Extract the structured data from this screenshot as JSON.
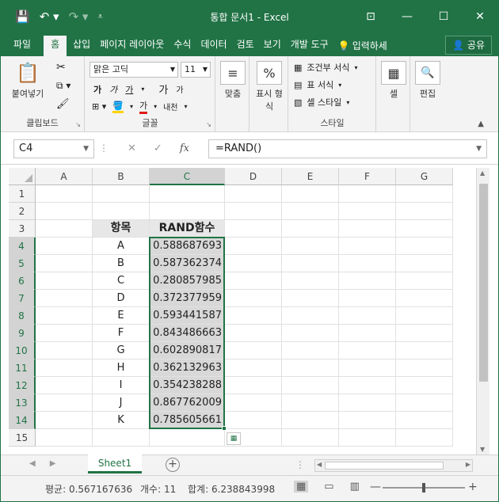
{
  "window": {
    "title": "통합 문서1 - Excel",
    "qat": {
      "save_icon": "save-icon",
      "undo_icon": "undo-icon",
      "redo_icon": "redo-icon"
    },
    "controls": [
      "ribbon-display-icon",
      "minimize-icon",
      "maximize-icon",
      "close-icon"
    ]
  },
  "tabs": [
    {
      "label": "파일"
    },
    {
      "label": "홈",
      "active": true
    },
    {
      "label": "삽입"
    },
    {
      "label": "페이지 레이아웃"
    },
    {
      "label": "수식"
    },
    {
      "label": "데이터"
    },
    {
      "label": "검토"
    },
    {
      "label": "보기"
    },
    {
      "label": "개발 도구"
    }
  ],
  "tell_me": "입력하세",
  "share": "공유",
  "ribbon": {
    "clipboard": {
      "paste_label": "붙여넣기",
      "group": "클립보드"
    },
    "font": {
      "name": "맑은 고딕",
      "size": "11",
      "group": "글꼴",
      "bold": "가",
      "italic": "가",
      "underline": "가",
      "grow": "가",
      "shrink": "가",
      "fontcolor": "가",
      "phonetic": "내천"
    },
    "alignment": {
      "label": "맞춤"
    },
    "number": {
      "label": "표시 형식"
    },
    "styles": {
      "cond": "조건부 서식",
      "table": "표 서식",
      "cell": "셀 스타일",
      "group": "스타일"
    },
    "cells": {
      "label": "셀"
    },
    "editing": {
      "label": "편집"
    }
  },
  "formula_bar": {
    "name_box": "C4",
    "cancel": "✕",
    "enter": "✓",
    "fx": "fx",
    "formula": "=RAND()"
  },
  "columns": [
    "A",
    "B",
    "C",
    "D",
    "E",
    "F",
    "G"
  ],
  "rows": [
    "1",
    "2",
    "3",
    "4",
    "5",
    "6",
    "7",
    "8",
    "9",
    "10",
    "11",
    "12",
    "13",
    "14",
    "15"
  ],
  "table": {
    "header_item": "항목",
    "header_rand": "RAND함수",
    "items": [
      "A",
      "B",
      "C",
      "D",
      "E",
      "F",
      "G",
      "H",
      "I",
      "J",
      "K"
    ],
    "values": [
      "0.588687693",
      "0.587362374",
      "0.280857985",
      "0.372377959",
      "0.593441587",
      "0.843486663",
      "0.602890817",
      "0.362132963",
      "0.354238288",
      "0.867762009",
      "0.785605661"
    ]
  },
  "sheets": [
    {
      "label": "Sheet1",
      "active": true
    }
  ],
  "status": {
    "average": "평균: 0.567167636",
    "count": "개수: 11",
    "sum": "합계: 6.238843998"
  },
  "colors": {
    "accent": "#217346",
    "selection_fill": "#d8d8d8",
    "header_fill": "#e7e7e7"
  }
}
